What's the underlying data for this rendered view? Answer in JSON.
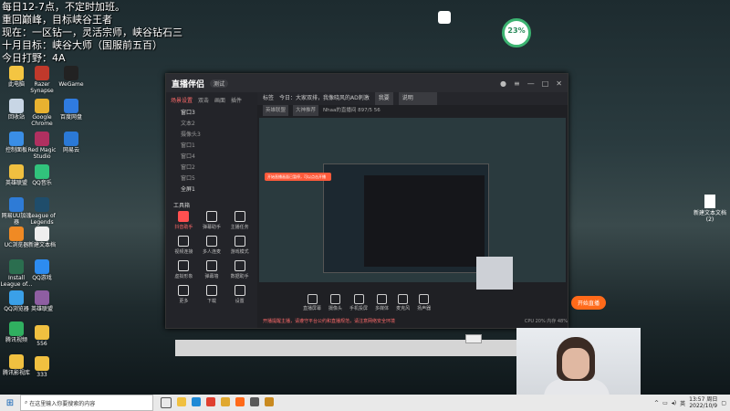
{
  "overlay_lines": [
    "每日12-7点，不定时加班。",
    "重回巅峰，目标峡谷王者",
    "现在：一区钻一，灵活宗师，峡谷钻石三",
    "十月目标：峡谷大师（国服前五百）",
    "今日打野：4A"
  ],
  "widget": {
    "score": "23",
    "score_unit": "%"
  },
  "desktop_icons": [
    {
      "label": "此电脑"
    },
    {
      "label": "Razer Synapse"
    },
    {
      "label": "WeGame"
    },
    {
      "label": "回收站"
    },
    {
      "label": "Google Chrome"
    },
    {
      "label": "百度网盘"
    },
    {
      "label": "控制面板"
    },
    {
      "label": "Red Magic Studio"
    },
    {
      "label": "网易云"
    },
    {
      "label": "英雄联盟"
    },
    {
      "label": "QQ音乐"
    },
    {
      "label": "网易UU加速器"
    },
    {
      "label": "League of Legends"
    },
    {
      "label": "UC浏览器"
    },
    {
      "label": "新建文本档"
    },
    {
      "label": "Install League of..."
    },
    {
      "label": "QQ游戏"
    },
    {
      "label": "QQ浏览器"
    },
    {
      "label": "英雄联盟"
    },
    {
      "label": "腾讯视频"
    },
    {
      "label": "556"
    },
    {
      "label": "腾讯影视库"
    },
    {
      "label": "333"
    }
  ],
  "right_file": {
    "label": "新建文本文档 (2)"
  },
  "app": {
    "logo": "直播伴侣",
    "version": "测试",
    "sidebar_tabs": [
      "场景设置",
      "双击",
      "画面",
      "插件"
    ],
    "scene_rows": [
      "窗口3",
      "文本2",
      "摄像头3",
      "窗口1",
      "窗口4",
      "窗口2",
      "窗口5",
      "全屏1"
    ],
    "tools_title": "工具箱",
    "tools": [
      {
        "label": "抖音助手",
        "hot": true
      },
      {
        "label": "弹幕助手",
        "hot": false
      },
      {
        "label": "主播任务",
        "hot": false
      },
      {
        "label": "视频连接",
        "hot": false
      },
      {
        "label": "多人连麦",
        "hot": false
      },
      {
        "label": "游戏模式",
        "hot": false
      },
      {
        "label": "虚拟形象",
        "hot": false
      },
      {
        "label": "弹幕墙",
        "hot": false
      },
      {
        "label": "数据助手",
        "hot": false
      },
      {
        "label": "更多",
        "hot": false
      },
      {
        "label": "下载",
        "hot": false
      },
      {
        "label": "设置",
        "hot": false
      }
    ],
    "notice_prefix": "标签",
    "notice": "今日：大家双排，我像晓风的AD刺激",
    "notice_tag": "我要",
    "notice_field": "说明",
    "meta_tag1": "英雄联盟",
    "meta_tag2": "大神推荐",
    "meta_text": "Nhaa的直播间  897/5  56",
    "preview_orange": "开始直播画面已暂停，可以点击开播",
    "bottom_buttons": [
      "直播屏幕",
      "摄像头",
      "手机投屏",
      "多媒体",
      "麦克风",
      "扬声器"
    ],
    "live_button": "开始直播",
    "status_warn": "开播提醒主播，请遵守平台公约和直播规范，请注意网络安全环境",
    "status_right": "CPU 20%  内存 48%"
  },
  "taskbar": {
    "search_placeholder": "在这里输入你要搜索的内容",
    "time": "13:57 周日",
    "date": "2022/10/9"
  }
}
